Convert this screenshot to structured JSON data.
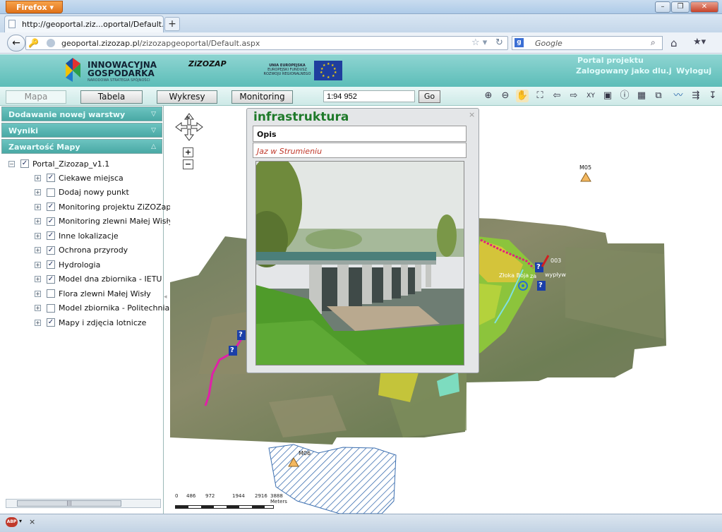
{
  "browser": {
    "app_button": "Firefox",
    "tab_title": "http://geoportal.ziz...oportal/Default.aspx",
    "new_tab": "+",
    "url_domain": "geoportal.zizozap.pl",
    "url_path": "/zizozapgeoportal/Default.aspx",
    "search_placeholder": "Google",
    "search_engine_badge": "g"
  },
  "header": {
    "logo_line1": "INNOWACYJNA",
    "logo_line2": "GOSPODARKA",
    "logo_sub": "NARODOWA STRATEGIA SPÓJNOŚCI",
    "project_logo": "ZiZOZAP",
    "eu_line1": "UNIA EUROPEJSKA",
    "eu_line2": "EUROPEJSKI FUNDUSZ",
    "eu_line3": "ROZWOJU REGIONALNEGO",
    "portal_title": "Portal projektu",
    "logged_as": "Zalogowany jako dlu.j",
    "logout": "Wyloguj"
  },
  "toolbar": {
    "tab_map": "Mapa",
    "tab_table": "Tabela",
    "tab_charts": "Wykresy",
    "tab_monitoring": "Monitoring",
    "scale_value": "1:94 952",
    "go": "Go",
    "tool_icons": [
      "zoom-in-icon",
      "zoom-out-icon",
      "pan-hand-icon",
      "zoom-extent-icon",
      "back-icon",
      "forward-icon",
      "xy-icon",
      "select-icon",
      "info-icon",
      "print-icon",
      "measure-icon",
      "line-icon",
      "export-icon"
    ]
  },
  "left_panel": {
    "section_add_layer": "Dodawanie nowej warstwy",
    "section_results": "Wyniki",
    "section_map_contents": "Zawartość Mapy",
    "root_layer": "Portal_Zizozap_v1.1",
    "layers": [
      {
        "label": "Ciekawe miejsca",
        "checked": true
      },
      {
        "label": "Dodaj nowy punkt",
        "checked": false
      },
      {
        "label": "Monitoring projektu ZiZOZap",
        "checked": true
      },
      {
        "label": "Monitoring zlewni Małej Wisły",
        "checked": true
      },
      {
        "label": "Inne lokalizacje",
        "checked": true
      },
      {
        "label": "Ochrona przyrody",
        "checked": true
      },
      {
        "label": "Hydrologia",
        "checked": true
      },
      {
        "label": "Model dna zbiornika - IETU",
        "checked": true
      },
      {
        "label": "Flora zlewni Małej Wisły",
        "checked": false
      },
      {
        "label": "Model zbiornika - Politechnia Krakowska",
        "checked": false
      },
      {
        "label": "Mapy i zdjęcia lotnicze",
        "checked": true
      }
    ]
  },
  "map": {
    "zoom_plus": "+",
    "zoom_minus": "−",
    "north": "N",
    "station_m05": "M05",
    "station_m06": "M06",
    "label_003": "003",
    "label_zlotka": "Złoka Boja",
    "label_za": "za",
    "label_wyplyw": "wypływ",
    "scalebar_ticks": [
      "0",
      "486",
      "972",
      "1944",
      "2916",
      "3888 Meters"
    ]
  },
  "popup": {
    "title": "infrastruktura",
    "field_header": "Opis",
    "field_value": "Jaz w Strumieniu",
    "close": "×"
  },
  "status": {
    "abp": "ABP",
    "close": "×"
  }
}
